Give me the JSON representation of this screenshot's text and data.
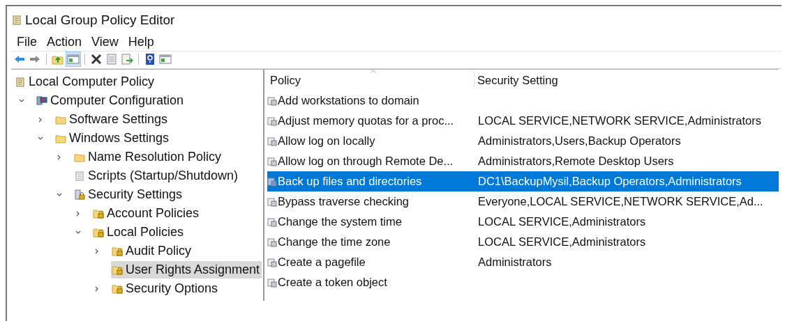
{
  "window": {
    "title": "Local Group Policy Editor"
  },
  "menu": [
    "File",
    "Action",
    "View",
    "Help"
  ],
  "toolbar": [
    {
      "kind": "back"
    },
    {
      "kind": "forward"
    },
    {
      "kind": "sep"
    },
    {
      "kind": "up"
    },
    {
      "kind": "pane",
      "selected": true
    },
    {
      "kind": "sep"
    },
    {
      "kind": "delete"
    },
    {
      "kind": "properties"
    },
    {
      "kind": "export"
    },
    {
      "kind": "sep"
    },
    {
      "kind": "help"
    },
    {
      "kind": "pane",
      "selected": false
    }
  ],
  "tree": {
    "label": "Local Computer Policy",
    "kind": "scroll",
    "selected": false,
    "children": [
      {
        "label": "Computer Configuration",
        "kind": "computer",
        "expanded": true,
        "selected": false,
        "children": [
          {
            "label": "Software Settings",
            "kind": "folder",
            "expanded": false,
            "selected": false
          },
          {
            "label": "Windows Settings",
            "kind": "folder",
            "expanded": true,
            "selected": false,
            "children": [
              {
                "label": "Name Resolution Policy",
                "kind": "folder",
                "expanded": false,
                "selected": false
              },
              {
                "label": "Scripts (Startup/Shutdown)",
                "kind": "script",
                "selected": false
              },
              {
                "label": "Security Settings",
                "kind": "security",
                "expanded": true,
                "selected": false,
                "children": [
                  {
                    "label": "Account Policies",
                    "kind": "lockfolder",
                    "expanded": false,
                    "selected": false
                  },
                  {
                    "label": "Local Policies",
                    "kind": "lockfolder",
                    "expanded": true,
                    "selected": false,
                    "children": [
                      {
                        "label": "Audit Policy",
                        "kind": "lockfolder",
                        "expanded": false,
                        "selected": false
                      },
                      {
                        "label": "User Rights Assignment",
                        "kind": "lockfolder",
                        "selected": true
                      },
                      {
                        "label": "Security Options",
                        "kind": "lockfolder",
                        "expanded": false,
                        "selected": false
                      }
                    ]
                  }
                ]
              }
            ]
          }
        ]
      }
    ]
  },
  "table": {
    "columns": [
      {
        "label": "Policy",
        "sorted": true
      },
      {
        "label": "Security Setting",
        "sorted": false
      }
    ],
    "rows": [
      {
        "policy": "Add workstations to domain",
        "setting": "",
        "selected": false
      },
      {
        "policy": "Adjust memory quotas for a proc...",
        "setting": "LOCAL SERVICE,NETWORK SERVICE,Administrators",
        "selected": false
      },
      {
        "policy": "Allow log on locally",
        "setting": "Administrators,Users,Backup Operators",
        "selected": false
      },
      {
        "policy": "Allow log on through Remote De...",
        "setting": "Administrators,Remote Desktop Users",
        "selected": false
      },
      {
        "policy": "Back up files and directories",
        "setting": "DC1\\BackupMysil,Backup Operators,Administrators",
        "selected": true
      },
      {
        "policy": "Bypass traverse checking",
        "setting": "Everyone,LOCAL SERVICE,NETWORK SERVICE,Ad...",
        "selected": false
      },
      {
        "policy": "Change the system time",
        "setting": "LOCAL SERVICE,Administrators",
        "selected": false
      },
      {
        "policy": "Change the time zone",
        "setting": "LOCAL SERVICE,Administrators",
        "selected": false
      },
      {
        "policy": "Create a pagefile",
        "setting": "Administrators",
        "selected": false
      },
      {
        "policy": "Create a token object",
        "setting": "",
        "selected": false
      }
    ]
  }
}
